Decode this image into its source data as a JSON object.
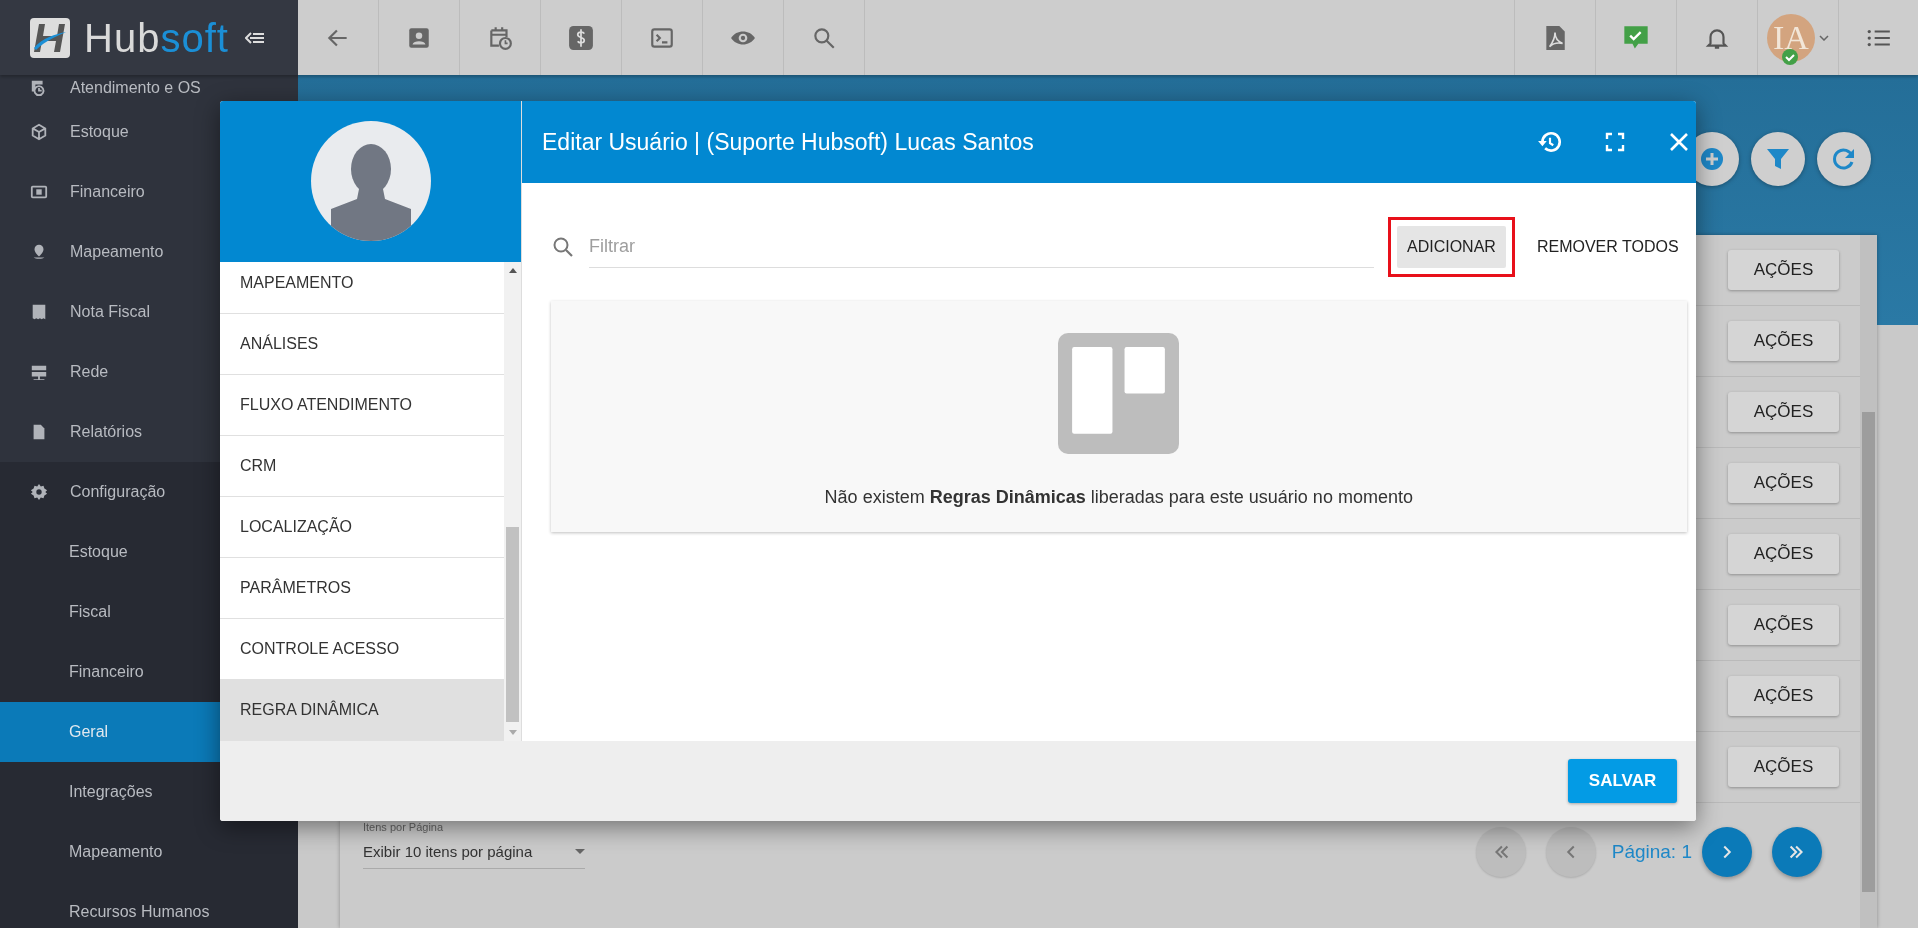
{
  "app_bar": {
    "logo": {
      "parts": [
        "Hub",
        "soft"
      ]
    },
    "avatar": {
      "initials": "IA"
    }
  },
  "sidebar": {
    "items": [
      {
        "label": "Atendimento e OS",
        "kind": "main",
        "selected": false
      },
      {
        "label": "Estoque",
        "kind": "main",
        "selected": false
      },
      {
        "label": "Financeiro",
        "kind": "main",
        "selected": false
      },
      {
        "label": "Mapeamento",
        "kind": "main",
        "selected": false
      },
      {
        "label": "Nota Fiscal",
        "kind": "main",
        "selected": false
      },
      {
        "label": "Rede",
        "kind": "main",
        "selected": false
      },
      {
        "label": "Relatórios",
        "kind": "main",
        "selected": false
      },
      {
        "label": "Configuração",
        "kind": "main",
        "selected": false,
        "expanded": true,
        "children": [
          {
            "label": "Estoque",
            "selected": false
          },
          {
            "label": "Fiscal",
            "selected": false
          },
          {
            "label": "Financeiro",
            "selected": false
          },
          {
            "label": "Geral",
            "selected": true
          },
          {
            "label": "Integrações",
            "selected": false
          },
          {
            "label": "Mapeamento",
            "selected": false
          },
          {
            "label": "Recursos Humanos",
            "selected": false
          }
        ]
      }
    ]
  },
  "page": {
    "actions": [
      "AÇÕES",
      "AÇÕES",
      "AÇÕES",
      "AÇÕES",
      "AÇÕES",
      "AÇÕES",
      "AÇÕES",
      "AÇÕES"
    ],
    "items_per_page": {
      "label": "Itens por Página",
      "value": "Exibir 10 itens por página"
    },
    "pagination": {
      "page": "Página: 1",
      "buttons": [
        {
          "kind": "first",
          "disabled": true
        },
        {
          "kind": "prev",
          "disabled": true
        },
        {
          "kind": "next",
          "disabled": false
        },
        {
          "kind": "last",
          "disabled": false
        }
      ]
    }
  },
  "modal": {
    "title": "Editar Usuário | (Suporte Hubsoft) Lucas Santos",
    "menu": [
      {
        "label": "MAPEAMENTO",
        "selected": false
      },
      {
        "label": "ANÁLISES",
        "selected": false
      },
      {
        "label": "FLUXO ATENDIMENTO",
        "selected": false
      },
      {
        "label": "CRM",
        "selected": false
      },
      {
        "label": "LOCALIZAÇÃO",
        "selected": false
      },
      {
        "label": "PARÂMETROS",
        "selected": false
      },
      {
        "label": "CONTROLE ACESSO",
        "selected": false
      },
      {
        "label": "REGRA DINÂMICA",
        "selected": true
      }
    ],
    "filter": {
      "placeholder": "Filtrar"
    },
    "add_button": {
      "label": "ADICIONAR",
      "highlighted": true
    },
    "remove_all_button": {
      "label": "REMOVER TODOS"
    },
    "empty_message": "Não existem **Regras Dinâmicas** liberadas para este usuário no momento",
    "save_button": "SALVAR"
  }
}
